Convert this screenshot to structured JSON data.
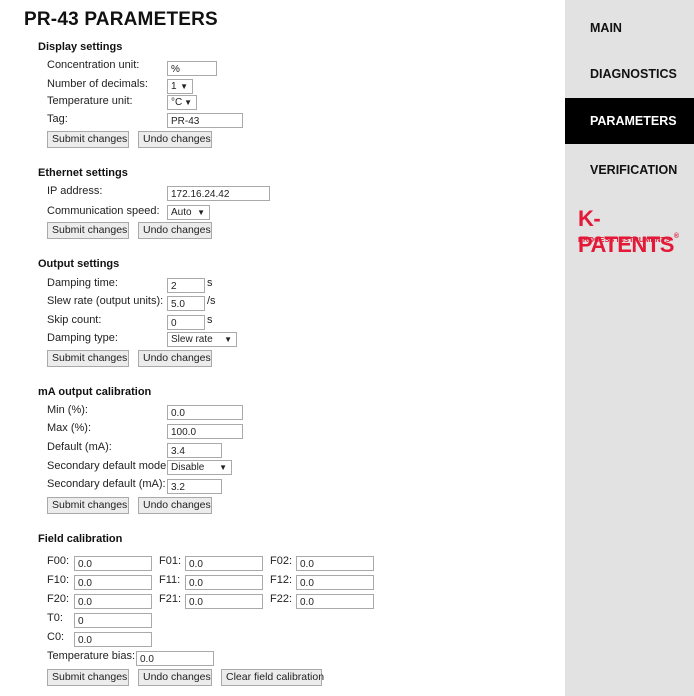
{
  "page_title": "PR-43 PARAMETERS",
  "nav": {
    "main": "MAIN",
    "diagnostics": "DIAGNOSTICS",
    "parameters": "PARAMETERS",
    "verification": "VERIFICATION"
  },
  "logo": {
    "name": "K-PATENTS",
    "registered": "®",
    "tagline": "PROCESS INSTRUMENTS"
  },
  "buttons": {
    "submit": "Submit changes",
    "undo": "Undo changes",
    "clear_field": "Clear field calibration"
  },
  "display": {
    "title": "Display settings",
    "concentration_unit_label": "Concentration unit:",
    "concentration_unit_value": "%",
    "decimals_label": "Number of decimals:",
    "decimals_value": "1",
    "temperature_unit_label": "Temperature unit:",
    "temperature_unit_value": "°C",
    "tag_label": "Tag:",
    "tag_value": "PR-43"
  },
  "ethernet": {
    "title": "Ethernet settings",
    "ip_label": "IP address:",
    "ip_value": "172.16.24.42",
    "speed_label": "Communication speed:",
    "speed_value": "Auto"
  },
  "output": {
    "title": "Output settings",
    "damping_label": "Damping time:",
    "damping_value": "2",
    "damping_unit": "s",
    "slew_label": "Slew rate (output units):",
    "slew_value": "5.0",
    "slew_unit": "/s",
    "skip_label": "Skip count:",
    "skip_value": "0",
    "skip_unit": "s",
    "damping_type_label": "Damping type:",
    "damping_type_value": "Slew rate"
  },
  "ma": {
    "title": "mA output calibration",
    "min_label": "Min (%):",
    "min_value": "0.0",
    "max_label": "Max (%):",
    "max_value": "100.0",
    "default_label": "Default (mA):",
    "default_value": "3.4",
    "sec_mode_label": "Secondary default mode:",
    "sec_mode_value": "Disable",
    "sec_default_label": "Secondary default (mA):",
    "sec_default_value": "3.2"
  },
  "field": {
    "title": "Field calibration",
    "f00_label": "F00:",
    "f00_value": "0.0",
    "f01_label": "F01:",
    "f01_value": "0.0",
    "f02_label": "F02:",
    "f02_value": "0.0",
    "f10_label": "F10:",
    "f10_value": "0.0",
    "f11_label": "F11:",
    "f11_value": "0.0",
    "f12_label": "F12:",
    "f12_value": "0.0",
    "f20_label": "F20:",
    "f20_value": "0.0",
    "f21_label": "F21:",
    "f21_value": "0.0",
    "f22_label": "F22:",
    "f22_value": "0.0",
    "t0_label": "T0:",
    "t0_value": "0",
    "c0_label": "C0:",
    "c0_value": "0.0",
    "temp_bias_label": "Temperature bias:",
    "temp_bias_value": "0.0"
  }
}
